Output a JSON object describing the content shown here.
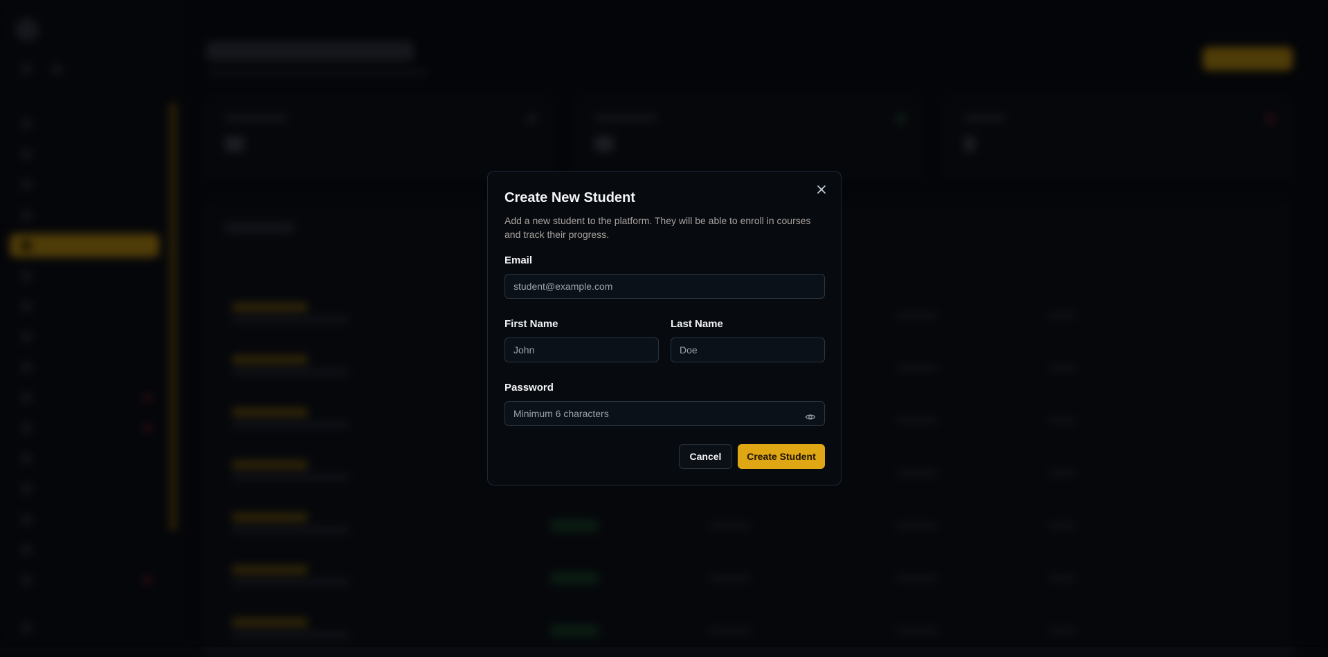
{
  "modal": {
    "title": "Create New Student",
    "description": "Add a new student to the platform. They will be able to enroll in courses and track their progress.",
    "email": {
      "label": "Email",
      "placeholder": "student@example.com",
      "value": ""
    },
    "first_name": {
      "label": "First Name",
      "placeholder": "John",
      "value": ""
    },
    "last_name": {
      "label": "Last Name",
      "placeholder": "Doe",
      "value": ""
    },
    "password": {
      "label": "Password",
      "placeholder": "Minimum 6 characters",
      "value": "",
      "toggle_icon": "eye-icon"
    },
    "cancel_label": "Cancel",
    "submit_label": "Create Student",
    "close_icon": "close-icon"
  },
  "colors": {
    "accent": "#e0a714",
    "modal_bg": "#070a0f",
    "input_border": "#2a3440",
    "background": "#06070b"
  }
}
